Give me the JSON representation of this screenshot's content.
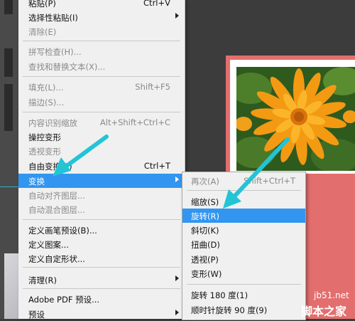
{
  "edit_menu": {
    "items": [
      {
        "label": "粘贴(P)",
        "shortcut": "Ctrl+V",
        "state": "normal"
      },
      {
        "label": "选择性粘贴(I)",
        "shortcut": "",
        "state": "submenu"
      },
      {
        "label": "清除(E)",
        "shortcut": "",
        "state": "disabled"
      },
      {
        "label": "拼写检查(H)...",
        "shortcut": "",
        "state": "disabled"
      },
      {
        "label": "查找和替换文本(X)...",
        "shortcut": "",
        "state": "disabled"
      },
      {
        "label": "填充(L)...",
        "shortcut": "Shift+F5",
        "state": "disabled"
      },
      {
        "label": "描边(S)...",
        "shortcut": "",
        "state": "disabled"
      },
      {
        "label": "内容识别缩放",
        "shortcut": "Alt+Shift+Ctrl+C",
        "state": "disabled"
      },
      {
        "label": "操控变形",
        "shortcut": "",
        "state": "normal"
      },
      {
        "label": "透视变形",
        "shortcut": "",
        "state": "disabled"
      },
      {
        "label": "自由变换(F)",
        "shortcut": "Ctrl+T",
        "state": "normal"
      },
      {
        "label": "变换",
        "shortcut": "",
        "state": "highlighted"
      },
      {
        "label": "自动对齐图层...",
        "shortcut": "",
        "state": "disabled"
      },
      {
        "label": "自动混合图层...",
        "shortcut": "",
        "state": "disabled"
      },
      {
        "label": "定义画笔预设(B)...",
        "shortcut": "",
        "state": "normal"
      },
      {
        "label": "定义图案...",
        "shortcut": "",
        "state": "normal"
      },
      {
        "label": "定义自定形状...",
        "shortcut": "",
        "state": "normal"
      },
      {
        "label": "清理(R)",
        "shortcut": "",
        "state": "submenu"
      },
      {
        "label": "Adobe PDF 预设...",
        "shortcut": "",
        "state": "normal"
      },
      {
        "label": "预设",
        "shortcut": "",
        "state": "submenu"
      }
    ]
  },
  "transform_submenu": {
    "items": [
      {
        "label": "再次(A)",
        "shortcut": "Shift+Ctrl+T",
        "state": "disabled"
      },
      {
        "label": "缩放(S)",
        "shortcut": "",
        "state": "normal"
      },
      {
        "label": "旋转(R)",
        "shortcut": "",
        "state": "highlighted"
      },
      {
        "label": "斜切(K)",
        "shortcut": "",
        "state": "normal"
      },
      {
        "label": "扭曲(D)",
        "shortcut": "",
        "state": "normal"
      },
      {
        "label": "透视(P)",
        "shortcut": "",
        "state": "normal"
      },
      {
        "label": "变形(W)",
        "shortcut": "",
        "state": "normal"
      },
      {
        "label": "旋转 180 度(1)",
        "shortcut": "",
        "state": "normal"
      },
      {
        "label": "顺时针旋转 90 度(9)",
        "shortcut": "",
        "state": "normal"
      }
    ]
  },
  "watermark": {
    "site": "jb51.net",
    "name": "脚本之家"
  },
  "colors": {
    "highlight": "#3295f0",
    "canvas": "#e36e6e",
    "arrow": "#22c4d6"
  }
}
